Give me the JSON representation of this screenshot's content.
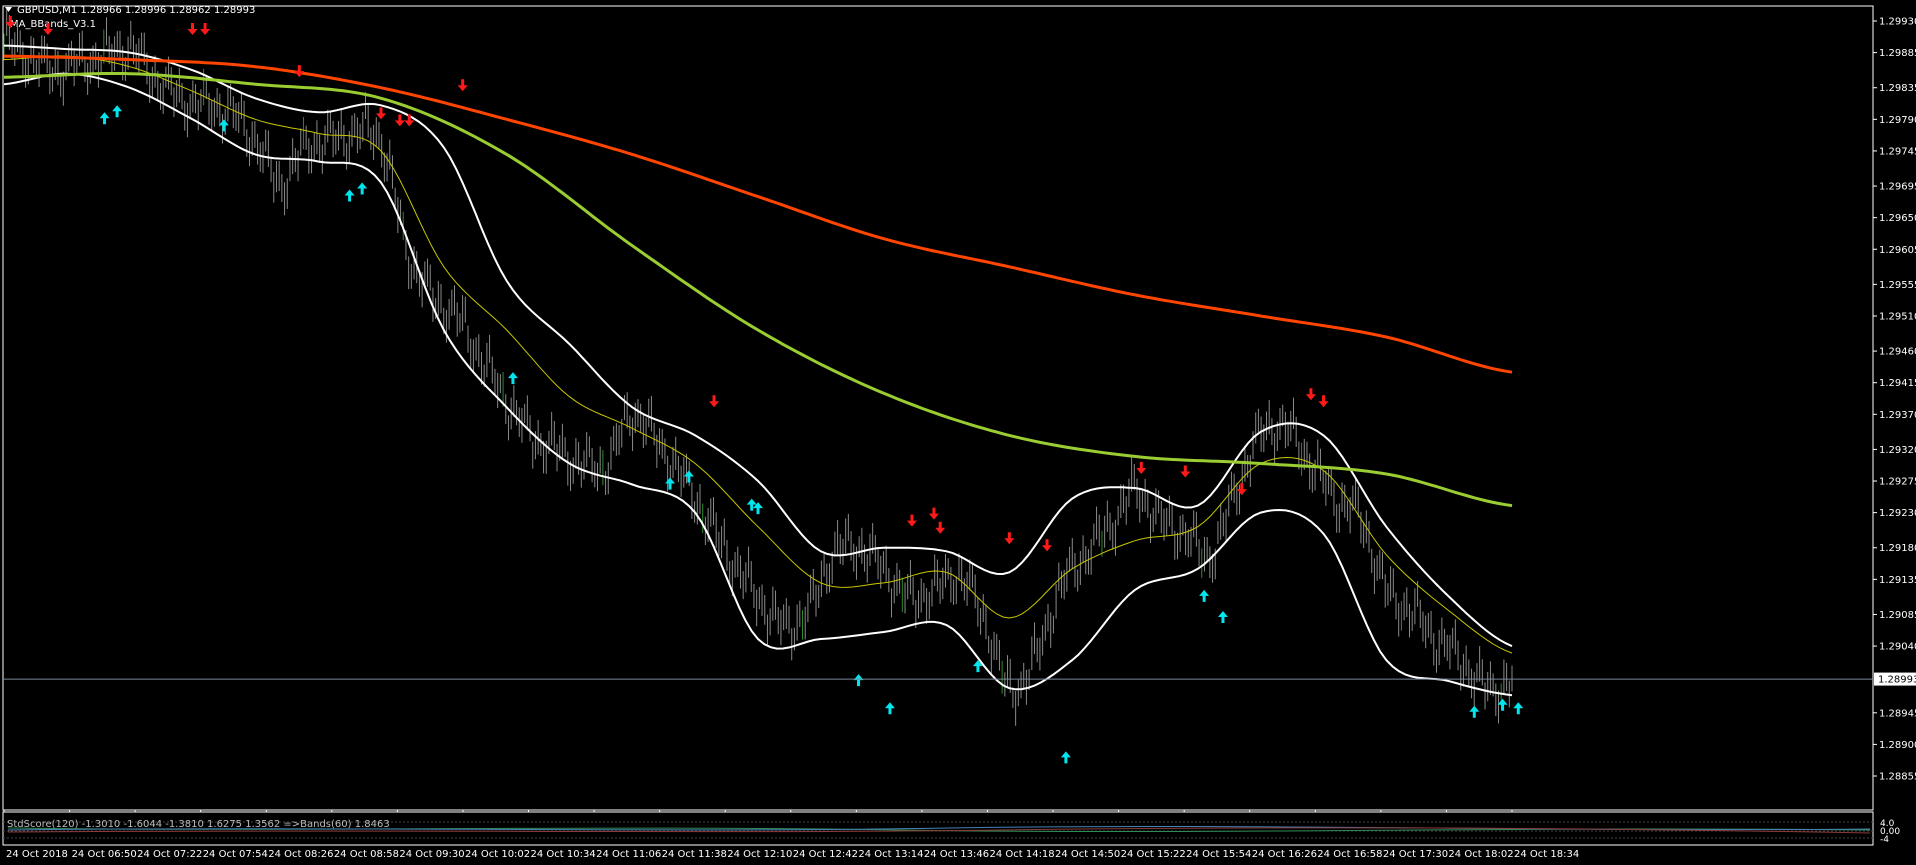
{
  "header": {
    "symbol_line": "GBPUSD,M1  1.28966 1.28996 1.28962 1.28993",
    "indicator_name": "MA_BBands_V3.1",
    "dropdown_icon": "triangle-down-icon"
  },
  "subwindow": {
    "label": "StdScore(120) -1.3010 -1.6044 -1.3810 1.6275 1.3562  =>Bands(60)  1.8463",
    "axis_top": "4.0",
    "axis_mid": "0.00",
    "axis_bottom": "-4"
  },
  "current_price": {
    "label": "1.28993",
    "value": 1.28993,
    "color": "#7a8a9a"
  },
  "colors": {
    "background": "#000000",
    "axis": "#ffffff",
    "candles": "#8a8a8a",
    "bands": "#ffffff",
    "ma_yellow": "#c8c800",
    "ma_green": "#9acd32",
    "ma_orange": "#ff4500",
    "arrow_up": "#00e5ee",
    "arrow_down": "#ff1a1a"
  },
  "chart_data": {
    "type": "line",
    "symbol": "GBPUSD",
    "timeframe": "M1",
    "ylim": [
      1.28855,
      1.2993
    ],
    "y_ticks": [
      "1.29930",
      "1.29885",
      "1.29835",
      "1.29790",
      "1.29745",
      "1.29695",
      "1.29650",
      "1.29605",
      "1.29555",
      "1.29510",
      "1.29460",
      "1.29415",
      "1.29370",
      "1.29320",
      "1.29275",
      "1.29230",
      "1.29180",
      "1.29135",
      "1.29085",
      "1.29040",
      "1.28945",
      "1.28900",
      "1.28855"
    ],
    "x_ticks": [
      "24 Oct 2018",
      "24 Oct 06:50",
      "24 Oct 07:22",
      "24 Oct 07:54",
      "24 Oct 08:26",
      "24 Oct 08:58",
      "24 Oct 09:30",
      "24 Oct 10:02",
      "24 Oct 10:34",
      "24 Oct 11:06",
      "24 Oct 11:38",
      "24 Oct 12:10",
      "24 Oct 12:42",
      "24 Oct 13:14",
      "24 Oct 13:46",
      "24 Oct 14:18",
      "24 Oct 14:50",
      "24 Oct 15:22",
      "24 Oct 15:54",
      "24 Oct 16:26",
      "24 Oct 16:58",
      "24 Oct 17:30",
      "24 Oct 18:02",
      "24 Oct 18:34"
    ],
    "x_span": [
      0,
      24
    ],
    "series": [
      {
        "key": "price",
        "x": [
          0,
          0.4,
          0.8,
          1.2,
          1.6,
          2.0,
          2.4,
          2.8,
          3.2,
          3.6,
          4.0,
          4.4,
          4.8,
          5.2,
          5.6,
          6.0,
          6.4,
          6.8,
          7.2,
          7.6,
          8.0,
          8.4,
          8.8,
          9.2,
          9.6,
          10.0,
          10.4,
          10.8,
          11.2,
          11.6,
          12.0,
          12.4,
          12.8,
          13.2,
          13.6,
          14.0,
          14.4,
          14.8,
          15.2,
          15.6,
          16.0,
          16.4,
          16.8,
          17.2,
          17.6,
          18.0,
          18.4,
          18.8,
          19.2,
          19.6,
          20.0,
          20.4,
          20.8,
          21.2,
          21.6,
          22.0,
          22.4,
          22.8,
          23.2,
          23.6,
          24.0
        ],
        "y": [
          1.299,
          1.2988,
          1.2986,
          1.2987,
          1.2988,
          1.2989,
          1.2985,
          1.2982,
          1.2981,
          1.298,
          1.2976,
          1.297,
          1.2975,
          1.2976,
          1.2977,
          1.2976,
          1.2961,
          1.2954,
          1.2951,
          1.2945,
          1.2939,
          1.2934,
          1.2932,
          1.293,
          1.293,
          1.2937,
          1.2933,
          1.2928,
          1.2922,
          1.2916,
          1.2911,
          1.2907,
          1.2909,
          1.2917,
          1.2918,
          1.2915,
          1.2911,
          1.2912,
          1.2914,
          1.2908,
          1.2898,
          1.2902,
          1.2912,
          1.2917,
          1.2921,
          1.2926,
          1.2922,
          1.292,
          1.2917,
          1.2926,
          1.2934,
          1.2935,
          1.293,
          1.2925,
          1.2922,
          1.2912,
          1.2909,
          1.2905,
          1.2902,
          1.2898,
          1.2899
        ]
      },
      {
        "key": "ma_yellow",
        "x": [
          0,
          1,
          2,
          3,
          4,
          5,
          6,
          7,
          8,
          9,
          10,
          11,
          12,
          13,
          14,
          15,
          16,
          17,
          18,
          19,
          20,
          21,
          22,
          23,
          24
        ],
        "y": [
          1.29875,
          1.2988,
          1.29865,
          1.2983,
          1.2979,
          1.2977,
          1.29745,
          1.2958,
          1.2949,
          1.29395,
          1.2935,
          1.293,
          1.2921,
          1.2913,
          1.2913,
          1.29145,
          1.2908,
          1.2915,
          1.2919,
          1.2921,
          1.293,
          1.2929,
          1.2917,
          1.2909,
          1.2903
        ]
      },
      {
        "key": "band_upper",
        "x": [
          0,
          1,
          2,
          3,
          4,
          5,
          6,
          7,
          8,
          9,
          10,
          11,
          12,
          13,
          14,
          15,
          16,
          17,
          18,
          19,
          20,
          21,
          22,
          23,
          24
        ],
        "y": [
          1.29895,
          1.2989,
          1.29885,
          1.2986,
          1.2982,
          1.298,
          1.2981,
          1.2975,
          1.2956,
          1.2947,
          1.2938,
          1.2934,
          1.29275,
          1.29175,
          1.2918,
          1.29175,
          1.29145,
          1.2925,
          1.29265,
          1.2924,
          1.29345,
          1.2934,
          1.2921,
          1.2911,
          1.2904
        ]
      },
      {
        "key": "band_lower",
        "x": [
          0,
          1,
          2,
          3,
          4,
          5,
          6,
          7,
          8,
          9,
          10,
          11,
          12,
          13,
          14,
          15,
          16,
          17,
          18,
          19,
          20,
          21,
          22,
          23,
          24
        ],
        "y": [
          1.2984,
          1.29855,
          1.29835,
          1.2979,
          1.2974,
          1.2973,
          1.297,
          1.2949,
          1.2938,
          1.293,
          1.2927,
          1.2923,
          1.2905,
          1.2905,
          1.2906,
          1.2907,
          1.2898,
          1.2902,
          1.2912,
          1.2915,
          1.2923,
          1.292,
          1.2902,
          1.2899,
          1.2897
        ]
      },
      {
        "key": "ma_green",
        "x": [
          0,
          2,
          4,
          6,
          8,
          10,
          12,
          14,
          16,
          18,
          20,
          22,
          24
        ],
        "y": [
          1.2985,
          1.29855,
          1.2984,
          1.2982,
          1.2974,
          1.2961,
          1.2949,
          1.294,
          1.2934,
          1.2931,
          1.293,
          1.29285,
          1.2924
        ]
      },
      {
        "key": "ma_orange",
        "x": [
          0,
          2,
          4,
          6,
          8,
          10,
          12,
          14,
          16,
          18,
          20,
          22,
          24
        ],
        "y": [
          1.2988,
          1.29875,
          1.29865,
          1.29835,
          1.2979,
          1.2974,
          1.2968,
          1.2962,
          1.2958,
          1.2954,
          1.2951,
          1.2948,
          1.2943
        ]
      }
    ],
    "arrows_up": [
      {
        "x": 1.6,
        "y": 1.298
      },
      {
        "x": 1.8,
        "y": 1.2981
      },
      {
        "x": 3.5,
        "y": 1.2979
      },
      {
        "x": 5.5,
        "y": 1.2969
      },
      {
        "x": 5.7,
        "y": 1.297
      },
      {
        "x": 8.1,
        "y": 1.2943
      },
      {
        "x": 10.6,
        "y": 1.2928
      },
      {
        "x": 10.9,
        "y": 1.2929
      },
      {
        "x": 11.9,
        "y": 1.2925
      },
      {
        "x": 12.0,
        "y": 1.29245
      },
      {
        "x": 13.6,
        "y": 1.29
      },
      {
        "x": 14.1,
        "y": 1.2896
      },
      {
        "x": 15.5,
        "y": 1.2902
      },
      {
        "x": 16.9,
        "y": 1.2889
      },
      {
        "x": 19.1,
        "y": 1.2912
      },
      {
        "x": 19.4,
        "y": 1.2909
      },
      {
        "x": 23.4,
        "y": 1.28955
      },
      {
        "x": 23.85,
        "y": 1.28965
      },
      {
        "x": 24.1,
        "y": 1.2896
      }
    ],
    "arrows_down": [
      {
        "x": 0.1,
        "y": 1.2992
      },
      {
        "x": 0.7,
        "y": 1.2991
      },
      {
        "x": 3.0,
        "y": 1.2991
      },
      {
        "x": 3.2,
        "y": 1.2991
      },
      {
        "x": 4.7,
        "y": 1.2985
      },
      {
        "x": 6.0,
        "y": 1.2979
      },
      {
        "x": 6.3,
        "y": 1.2978
      },
      {
        "x": 6.45,
        "y": 1.2978
      },
      {
        "x": 7.3,
        "y": 1.2983
      },
      {
        "x": 11.3,
        "y": 1.2938
      },
      {
        "x": 14.45,
        "y": 1.2921
      },
      {
        "x": 14.8,
        "y": 1.2922
      },
      {
        "x": 14.9,
        "y": 1.292
      },
      {
        "x": 16.0,
        "y": 1.29185
      },
      {
        "x": 16.6,
        "y": 1.29175
      },
      {
        "x": 18.1,
        "y": 1.29285
      },
      {
        "x": 18.8,
        "y": 1.2928
      },
      {
        "x": 19.7,
        "y": 1.29255
      },
      {
        "x": 20.8,
        "y": 1.2939
      },
      {
        "x": 21.0,
        "y": 1.2938
      }
    ]
  }
}
